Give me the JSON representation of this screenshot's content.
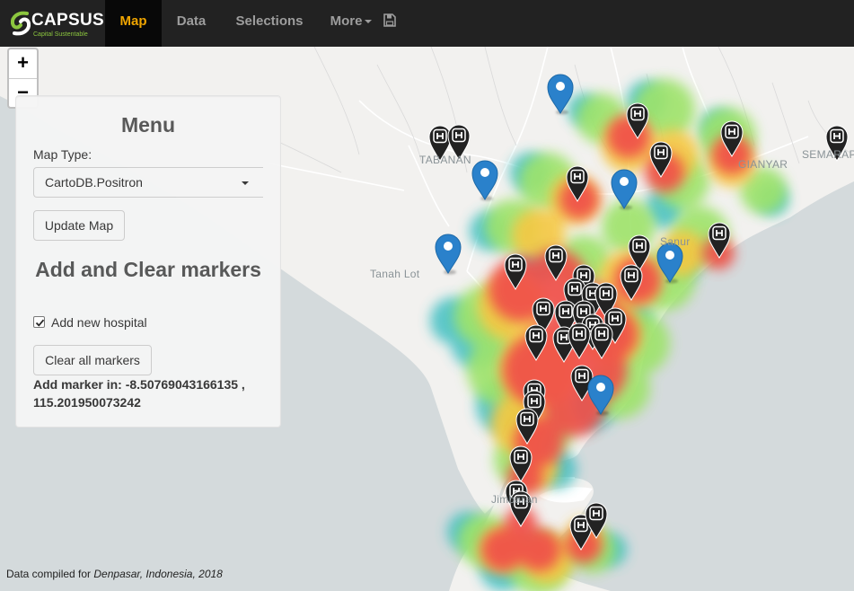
{
  "brand": {
    "name": "CAPSUS",
    "tagline": "Capital Sustentable"
  },
  "nav": {
    "tabs": [
      {
        "label": "Map",
        "active": true
      },
      {
        "label": "Data",
        "active": false
      },
      {
        "label": "Selections",
        "active": false
      },
      {
        "label": "More",
        "active": false,
        "dropdown": true
      }
    ],
    "save_icon": "floppy-disk-icon"
  },
  "zoom": {
    "in_label": "+",
    "out_label": "−"
  },
  "menu": {
    "title": "Menu",
    "map_type_label": "Map Type:",
    "map_type_value": "CartoDB.Positron",
    "update_button": "Update Map",
    "section_title": "Add and Clear markers",
    "add_hospital_label": "Add new hospital",
    "add_hospital_checked": true,
    "clear_button": "Clear all markers",
    "add_marker_label": "Add marker in:",
    "add_marker_lat": "-8.50769043166135",
    "add_marker_lng": "115.201950073242",
    "add_marker_text": "Add marker in: -8.50769043166135 , 115.201950073242"
  },
  "map_labels": {
    "tabanan": "TABANAN",
    "tanah_lot": "Tanah Lot",
    "gianyar": "GIANYAR",
    "semarapura": "SEMARAP",
    "sanur": "Sanur",
    "jimbaran": "Jimbaran"
  },
  "footer": {
    "prefix": "Data compiled for ",
    "place": "Denpasar, Indonesia, 2018"
  },
  "colors": {
    "navbar": "#222222",
    "active_tab": "#f0a500",
    "land": "#f2f1ef",
    "water": "#d4dadc",
    "heat_high": "#f0504a",
    "heat_mid": "#f5c842",
    "heat_low": "#9ee36a",
    "heat_edge": "#3fbfc2",
    "hospital_marker": "#222222",
    "location_marker": "#2a81cb"
  },
  "icons": {
    "hospital_marker": "hospital-map-marker-icon",
    "location_marker": "blue-map-pin-icon"
  }
}
